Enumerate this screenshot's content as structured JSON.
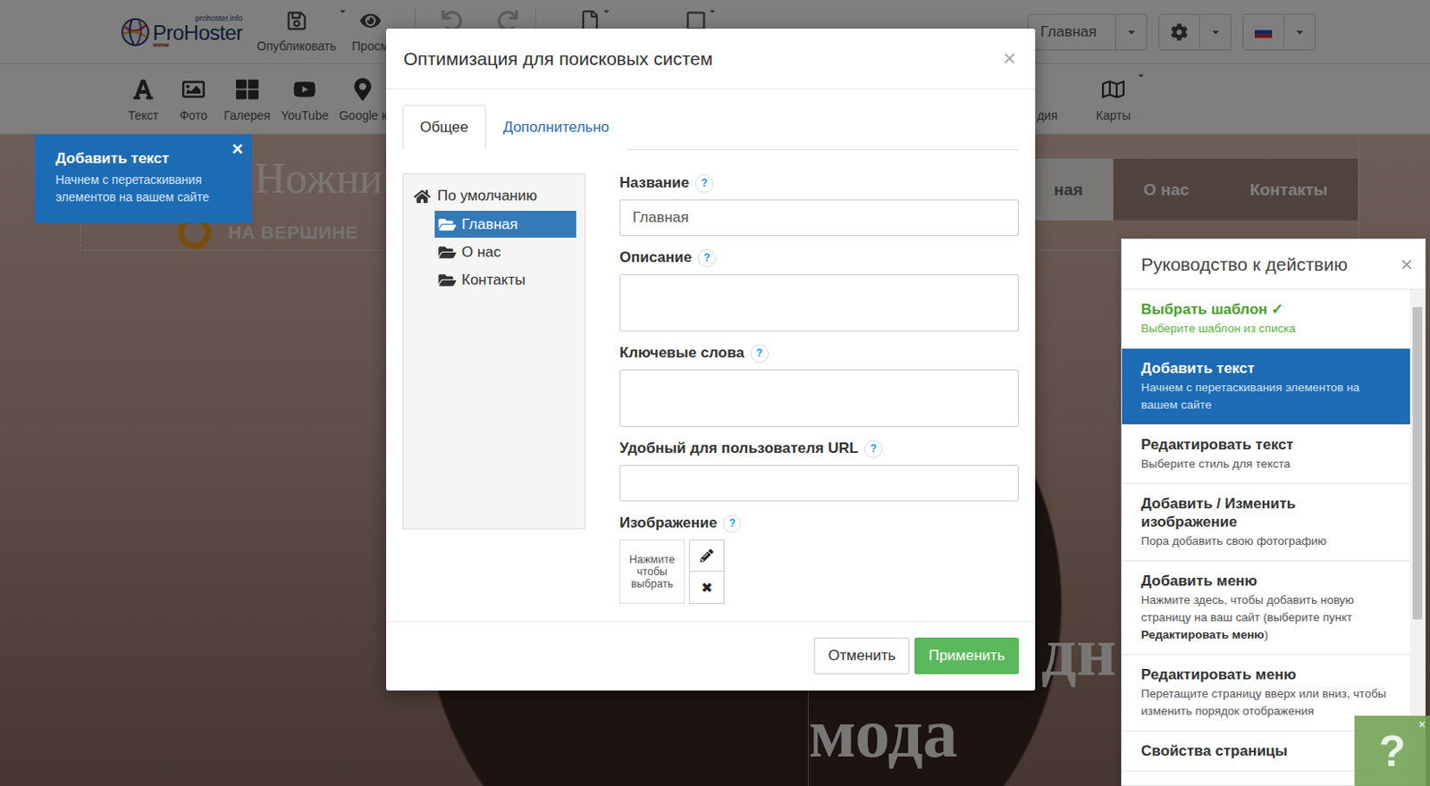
{
  "toolbar": {
    "logo": {
      "domain": "prohoster.info",
      "name": "ProHoster",
      "www": "www"
    },
    "actions": [
      {
        "label": "Опубликовать",
        "dropdown": true
      },
      {
        "label": "Просм",
        "dropdown": false
      }
    ],
    "page_select": {
      "value": "Главная"
    }
  },
  "widgets": {
    "left": [
      "Текст",
      "Фото",
      "Галерея",
      "YouTube",
      "Google к"
    ],
    "right": [
      {
        "label": "дия",
        "dropdown": false
      },
      {
        "label": "Карты",
        "dropdown": true
      }
    ]
  },
  "tooltip": {
    "title": "Добавить текст",
    "text": "Начнем с перетаскивания элементов на вашем сайте",
    "close": "×"
  },
  "site": {
    "logo_text": "Ножни",
    "tagline": "НА ВЕРШИНЕ",
    "nav": [
      {
        "label": "ная",
        "selected": true
      },
      {
        "label": "О нас",
        "selected": false
      },
      {
        "label": "Контакты",
        "selected": false
      }
    ],
    "hero": [
      "дн",
      "мода"
    ]
  },
  "guide": {
    "title": "Руководство к действию",
    "close": "×",
    "items": [
      {
        "title": "Выбрать шаблон",
        "check": "✓",
        "desc": "Выберите шаблон из списка",
        "strong": "",
        "desc_end": "",
        "done": true,
        "selected": false
      },
      {
        "title": "Добавить текст",
        "check": "",
        "desc": "Начнем с перетаскивания элементов на вашем сайте",
        "strong": "",
        "desc_end": "",
        "done": false,
        "selected": true
      },
      {
        "title": "Редактировать текст",
        "check": "",
        "desc": "Выберите стиль для текста",
        "strong": "",
        "desc_end": "",
        "done": false,
        "selected": false
      },
      {
        "title": "Добавить / Изменить изображение",
        "check": "",
        "desc": "Пора добавить свою фотографию",
        "strong": "",
        "desc_end": "",
        "done": false,
        "selected": false
      },
      {
        "title": "Добавить меню",
        "check": "",
        "desc": "Нажмите здесь, чтобы добавить новую страницу на ваш сайт (выберите пункт ",
        "strong": "Редактировать меню",
        "desc_end": ")",
        "done": false,
        "selected": false
      },
      {
        "title": "Редактировать меню",
        "check": "",
        "desc": "Перетащите страницу вверх или вниз, чтобы изменить порядок отображения",
        "strong": "",
        "desc_end": "",
        "done": false,
        "selected": false
      },
      {
        "title": "Свойства страницы",
        "check": "",
        "desc": "",
        "strong": "",
        "desc_end": "",
        "done": false,
        "selected": false
      }
    ]
  },
  "help_button": {
    "label": "?",
    "close": "×"
  },
  "dialog": {
    "title": "Оптимизация для поисковых систем",
    "close": "×",
    "tabs": [
      {
        "label": "Общее",
        "selected": true
      },
      {
        "label": "Дополнительно",
        "selected": false
      }
    ],
    "tree": {
      "root": "По умолчанию",
      "pages": [
        {
          "label": "Главная",
          "selected": true
        },
        {
          "label": "О нас",
          "selected": false
        },
        {
          "label": "Контакты",
          "selected": false
        }
      ]
    },
    "fields": [
      {
        "label": "Название",
        "help": "?",
        "kind": "input",
        "value": "Главная"
      },
      {
        "label": "Описание",
        "help": "?",
        "kind": "textarea",
        "value": ""
      },
      {
        "label": "Ключевые слова",
        "help": "?",
        "kind": "textarea",
        "value": ""
      },
      {
        "label": "Удобный для пользователя URL",
        "help": "?",
        "kind": "input",
        "value": ""
      }
    ],
    "image_field": {
      "label": "Изображение",
      "help": "?",
      "placeholder": "Нажмите чтобы выбрать",
      "remove": "✖"
    },
    "buttons": [
      {
        "label": "Отменить",
        "kind": "default"
      },
      {
        "label": "Применить",
        "kind": "primary"
      }
    ]
  }
}
